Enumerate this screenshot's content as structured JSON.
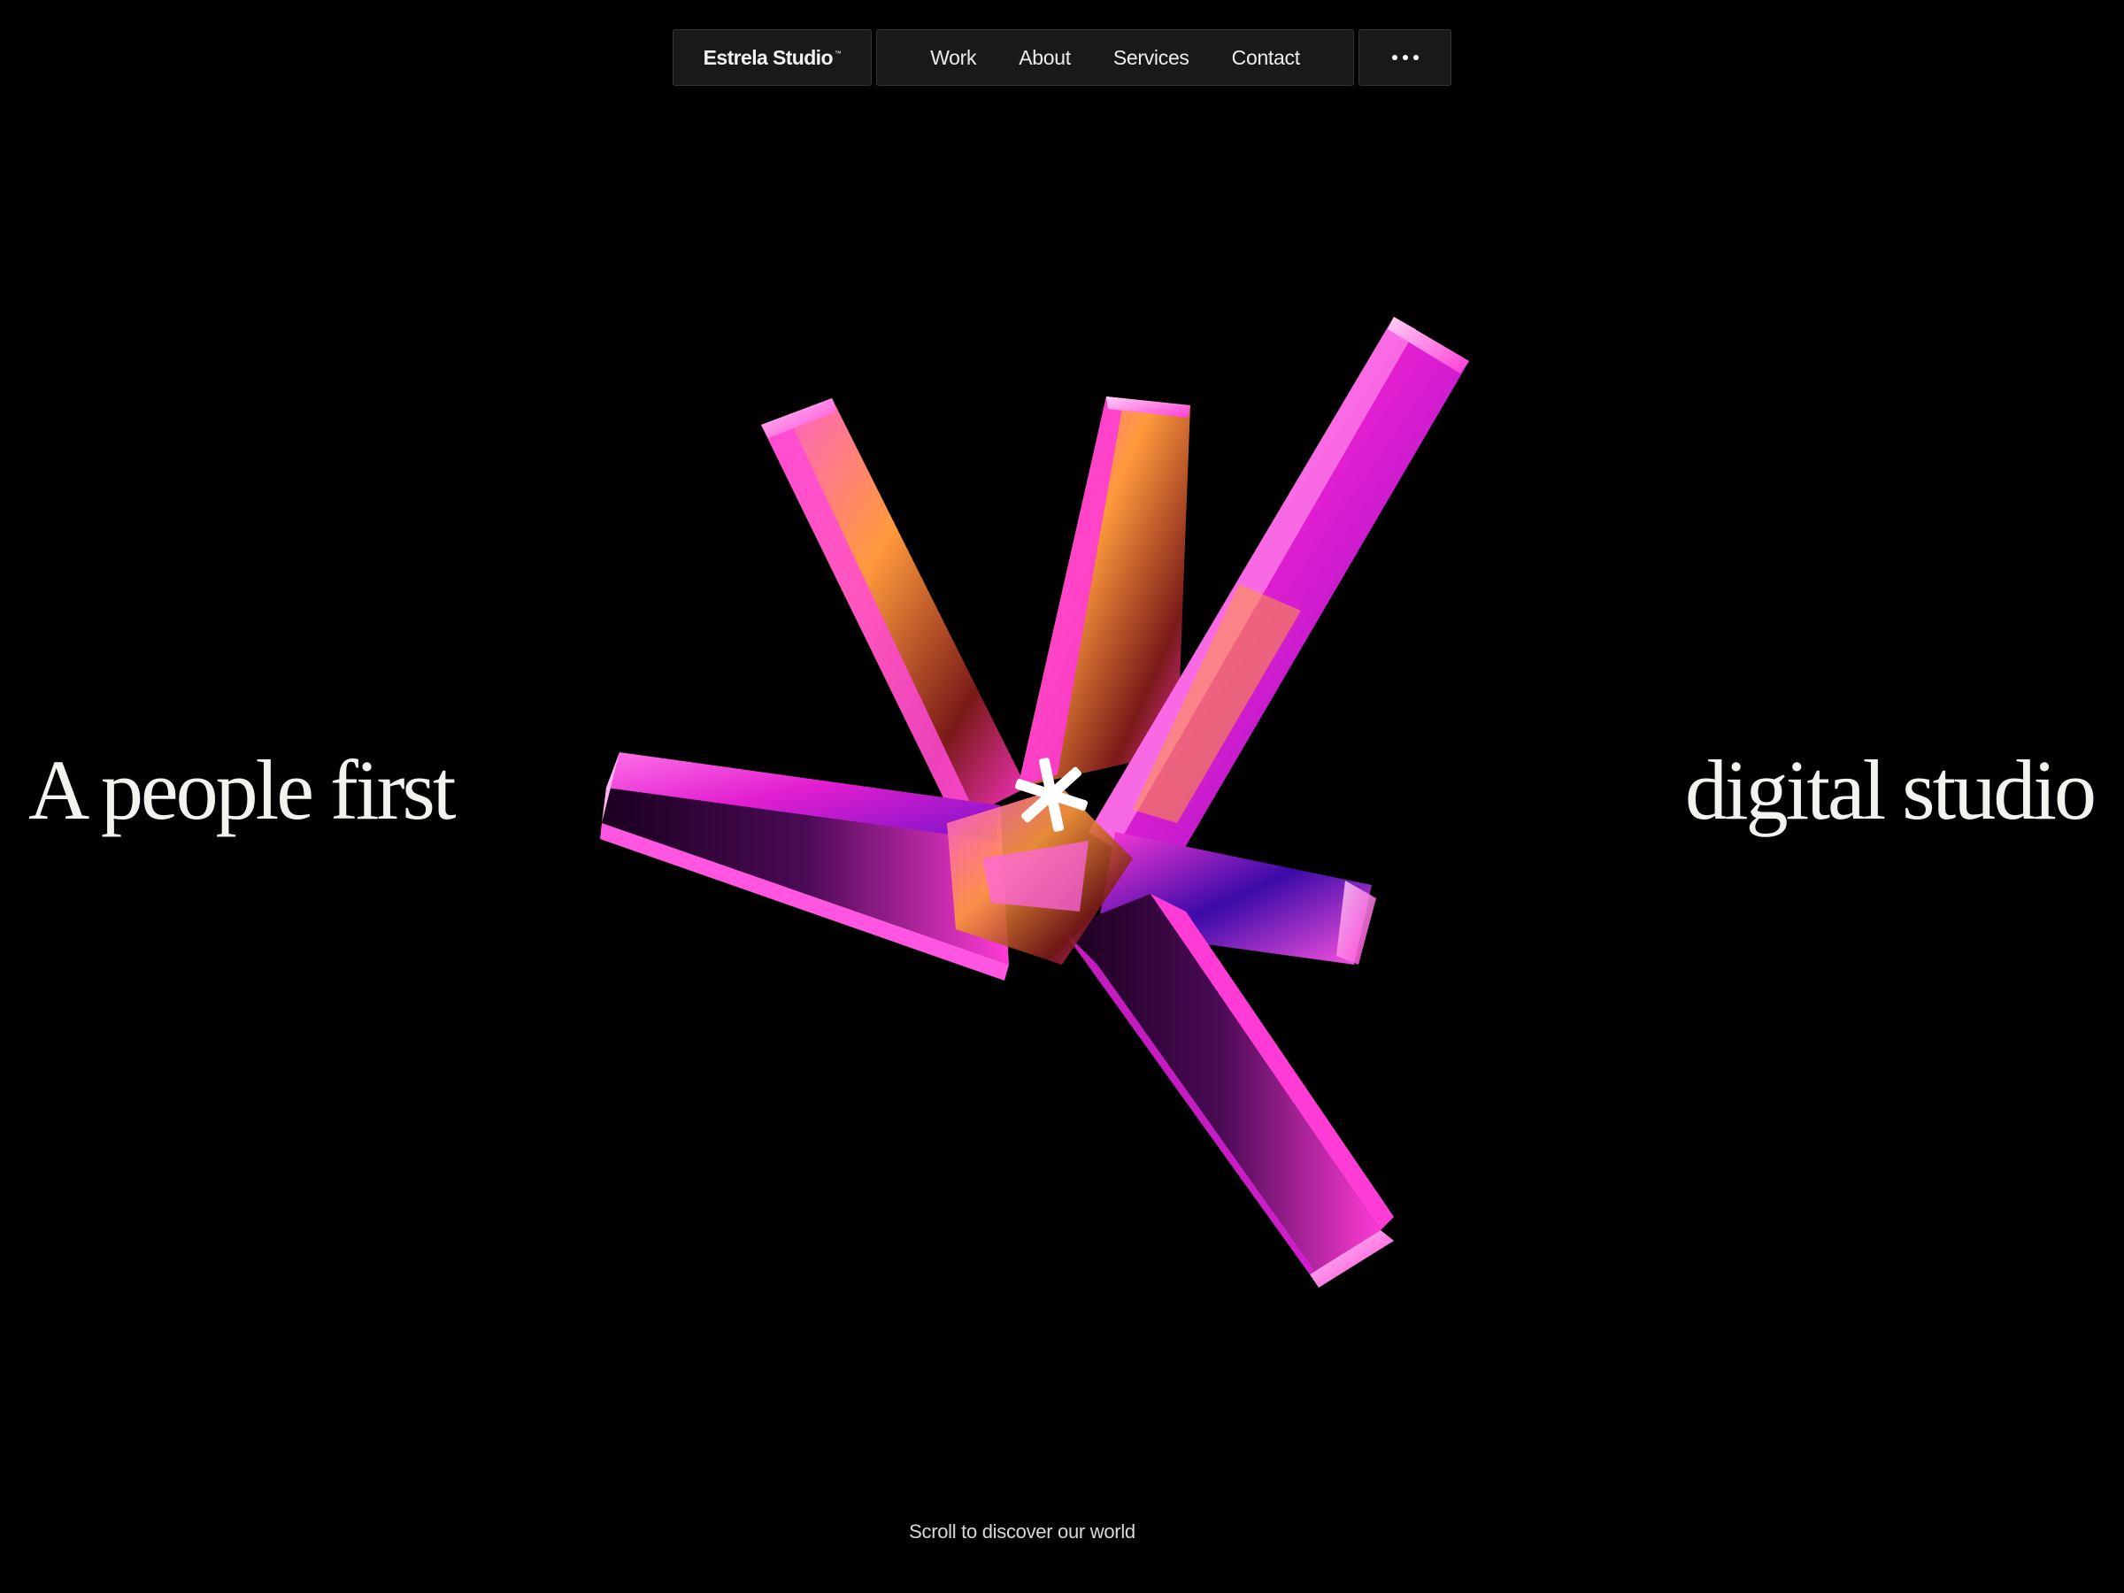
{
  "nav": {
    "brand": "Estrela Studio",
    "brand_mark": "™",
    "links": [
      "Work",
      "About",
      "Services",
      "Contact"
    ],
    "more_icon": "ellipsis-icon"
  },
  "hero": {
    "left": "A people first",
    "right": "digital studio",
    "graphic_icon": "crystal-star-graphic",
    "center_icon": "asterisk-icon"
  },
  "footer": {
    "scroll_hint": "Scroll to discover our world"
  },
  "colors": {
    "background": "#000000",
    "nav_bg": "#191919",
    "nav_border": "#343434",
    "text": "#f4f2ee",
    "magenta": "#ff2bd6",
    "violet": "#8a2be2",
    "amber": "#ff9a3c"
  }
}
